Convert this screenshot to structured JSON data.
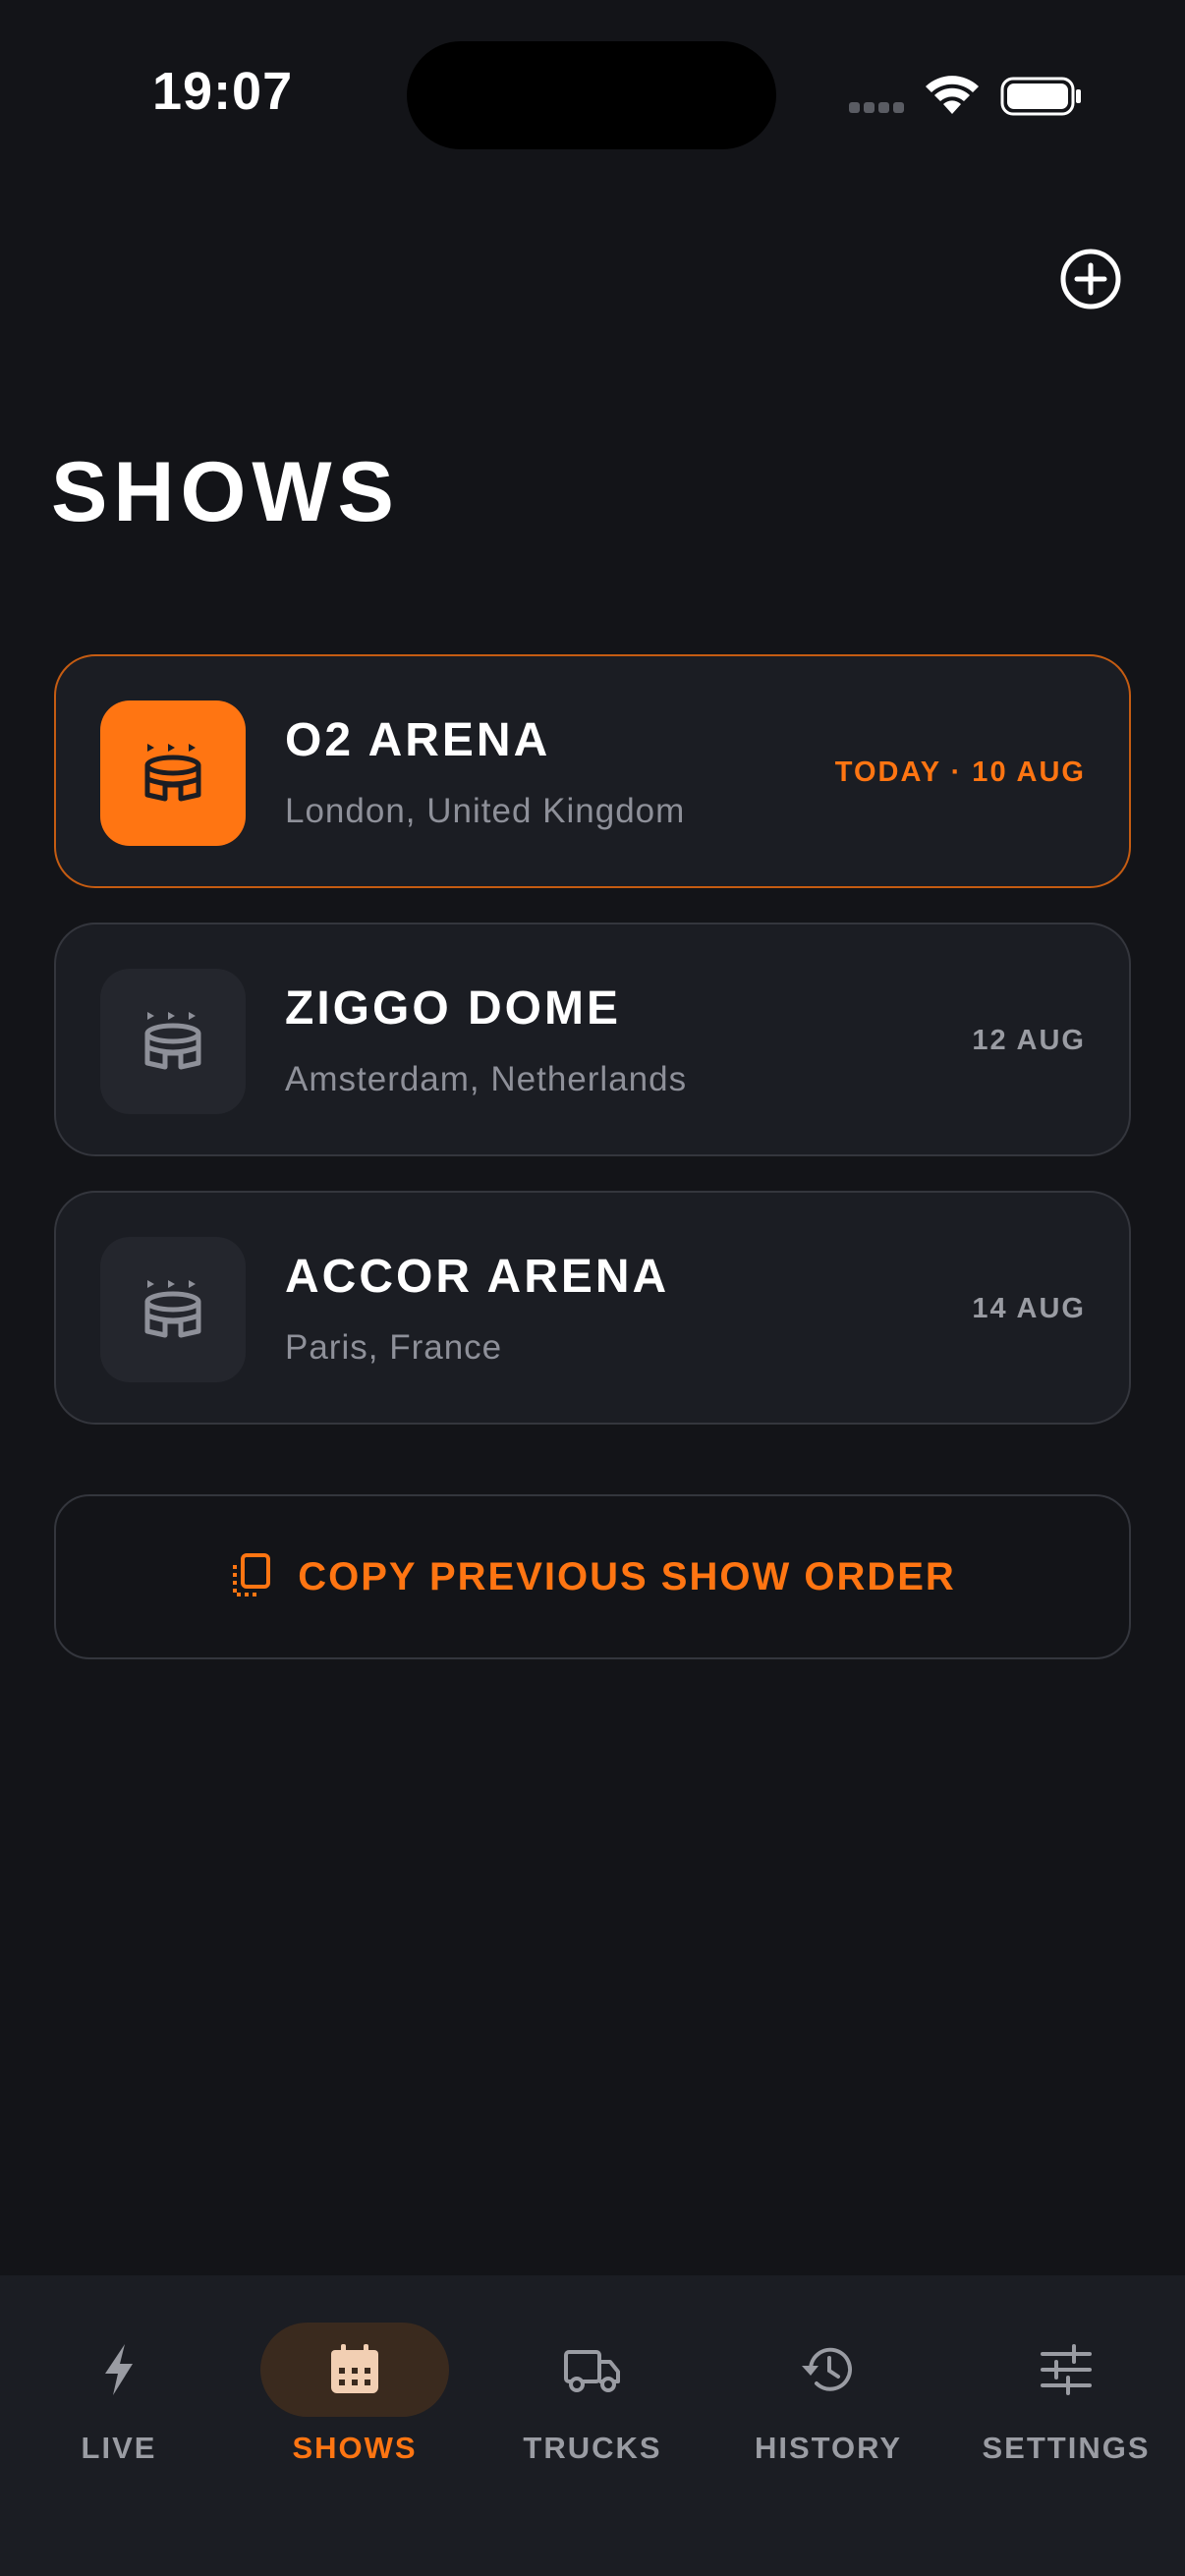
{
  "status": {
    "time": "19:07"
  },
  "page": {
    "title": "SHOWS"
  },
  "shows": [
    {
      "name": "O2 ARENA",
      "location": "London, United Kingdom",
      "date": "TODAY · 10 AUG",
      "active": true
    },
    {
      "name": "ZIGGO DOME",
      "location": "Amsterdam, Netherlands",
      "date": "12 AUG",
      "active": false
    },
    {
      "name": "ACCOR ARENA",
      "location": "Paris, France",
      "date": "14 AUG",
      "active": false
    }
  ],
  "copy_button": {
    "label": "COPY PREVIOUS SHOW ORDER"
  },
  "tabs": [
    {
      "label": "LIVE",
      "icon": "bolt-icon",
      "active": false
    },
    {
      "label": "SHOWS",
      "icon": "calendar-icon",
      "active": true
    },
    {
      "label": "TRUCKS",
      "icon": "truck-icon",
      "active": false
    },
    {
      "label": "HISTORY",
      "icon": "history-icon",
      "active": false
    },
    {
      "label": "SETTINGS",
      "icon": "sliders-icon",
      "active": false
    }
  ],
  "colors": {
    "accent": "#ff7512",
    "background": "#131418",
    "card": "#1b1d23",
    "muted": "#9a9ca3"
  }
}
